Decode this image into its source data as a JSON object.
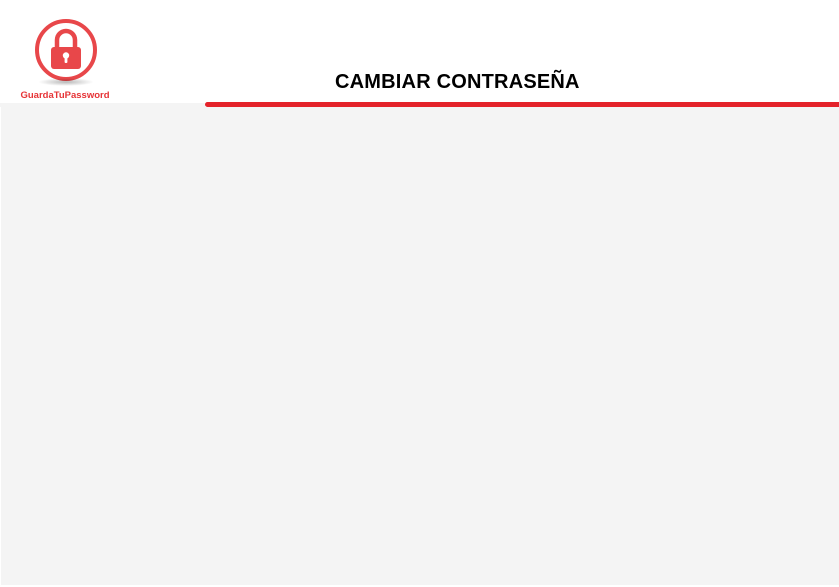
{
  "brand": {
    "name": "GuardaTuPassword",
    "logo_icon": "padlock-icon",
    "accent_color": "#e4222a"
  },
  "header": {
    "title": "CAMBIAR CONTRASEÑA"
  },
  "colors": {
    "background": "#ffffff",
    "content_background": "#f4f4f4",
    "underline": "#e4222a",
    "logo_red": "#e63336"
  }
}
